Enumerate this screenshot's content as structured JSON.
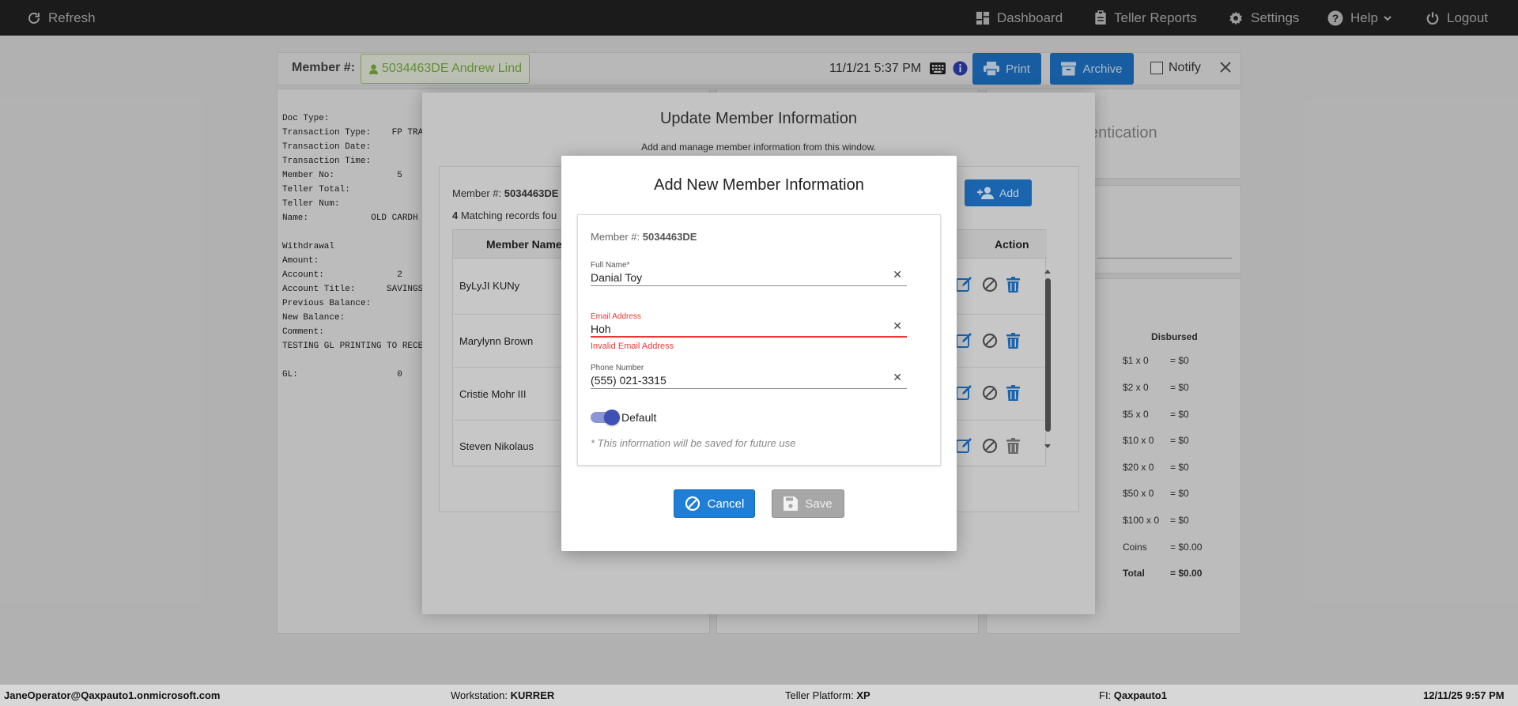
{
  "topbar": {
    "refresh": "Refresh",
    "dashboard": "Dashboard",
    "teller_reports": "Teller Reports",
    "settings": "Settings",
    "help": "Help",
    "logout": "Logout"
  },
  "member_bar": {
    "label": "Member #:",
    "member": "5034463DE Andrew Lind",
    "datetime": "11/1/21 5:37 PM",
    "print": "Print",
    "archive": "Archive",
    "notify": "Notify"
  },
  "receipt": {
    "lines": "Doc Type:\nTransaction Type:    FP TRA\nTransaction Date:\nTransaction Time:\nMember No:            5\nTeller Total:\nTeller Num:\nName:            OLD CARDH\n\nWithdrawal\nAmount:\nAccount:              2\nAccount Title:      SAVINGS\nPrevious Balance:\nNew Balance:\nComment:\nTESTING GL PRINTING TO RECE\n\nGL:                   0"
  },
  "right_panel": {
    "auth_text": "entication",
    "disbursed": "Disbursed",
    "rows": [
      {
        "a": "$1 x 0",
        "b": "= $0"
      },
      {
        "a": "$2 x 0",
        "b": "= $0"
      },
      {
        "a": "$5 x 0",
        "b": "= $0"
      },
      {
        "a": "$10 x 0",
        "b": "= $0"
      },
      {
        "a": "$20 x 0",
        "b": "= $0"
      },
      {
        "a": "$50 x 0",
        "b": "= $0"
      },
      {
        "a": "$100 x 0",
        "b": "= $0"
      },
      {
        "a": "Coins",
        "b": "= $0.00"
      },
      {
        "a": "Total",
        "b": "= $0.00"
      }
    ]
  },
  "update_modal": {
    "title": "Update Member Information",
    "subtitle": "Add and manage member information from this window.",
    "member_label": "Member #:",
    "member_no": "5034463DE",
    "match_count": "4",
    "match_text": " Matching records fou",
    "add": "Add",
    "col_name": "Member Name",
    "col_action": "Action",
    "rows": [
      "ByLyJI KUNy",
      "Marylynn Brown",
      "Cristie Mohr III",
      "Steven Nikolaus"
    ]
  },
  "add_modal": {
    "title": "Add New Member Information",
    "member_label": "Member #:",
    "member_no": "5034463DE",
    "full_name_label": "Full Name*",
    "full_name": "Danial Toy",
    "email_label": "Email Address",
    "email": "Hoh",
    "email_error": "Invalid Email Address",
    "phone_label": "Phone Number",
    "phone": "(555) 021-3315",
    "default_label": "Default",
    "default_on": true,
    "note": "* This information will be saved for future use",
    "cancel": "Cancel",
    "save": "Save"
  },
  "status": {
    "user": "JaneOperator@Qaxpauto1.onmicrosoft.com",
    "workstation_label": "Workstation:",
    "workstation": "KURRER",
    "platform_label": "Teller Platform:",
    "platform": "XP",
    "fi_label": "FI:",
    "fi": "Qaxpauto1",
    "datetime": "12/11/25 9:57 PM"
  },
  "colors": {
    "accent": "#1f73c8",
    "error": "#e53935",
    "toggle": "#3f51b5"
  }
}
